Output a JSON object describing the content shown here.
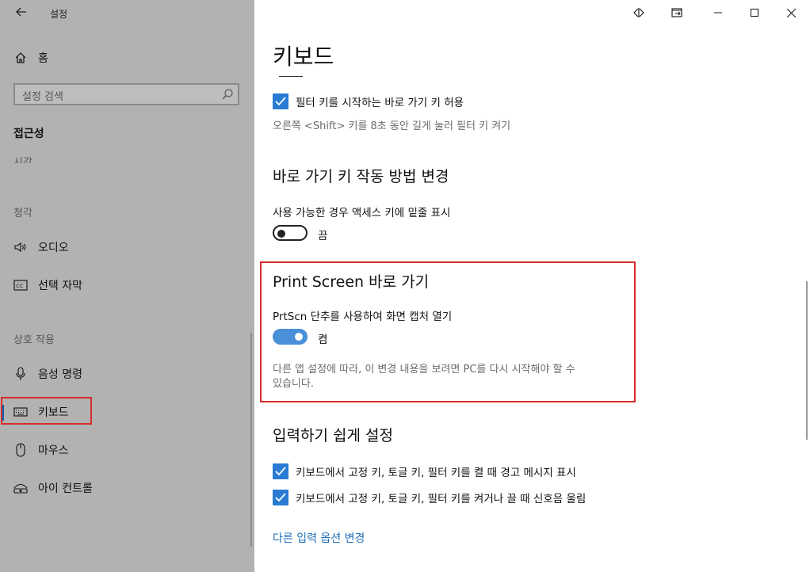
{
  "app": {
    "title": "설정"
  },
  "sidebar": {
    "home_label": "홈",
    "search_placeholder": "설정 검색",
    "section_title": "접근성",
    "group_vision": "시각",
    "group_hearing": "청각",
    "group_interaction": "상호 작용",
    "items": [
      {
        "label": "오디오",
        "icon": "speaker-icon"
      },
      {
        "label": "선택 자막",
        "icon": "closed-caption-icon"
      },
      {
        "label": "음성 명령",
        "icon": "microphone-icon"
      },
      {
        "label": "키보드",
        "icon": "keyboard-icon",
        "selected": true
      },
      {
        "label": "마우스",
        "icon": "mouse-icon"
      },
      {
        "label": "아이 컨트롤",
        "icon": "eye-icon"
      }
    ]
  },
  "main": {
    "page_title": "키보드",
    "filter_shortcut": {
      "label": "필터 키를 시작하는 바로 가기 키 허용",
      "checked": true,
      "help": "오른쪽 <Shift> 키를 8초 동안 길게 눌러 필터 키 켜기"
    },
    "shortcut_section": {
      "title": "바로 가기 키 작동 방법 변경",
      "setting_label": "사용 가능한 경우 액세스 키에 밑줄 표시",
      "toggle_state": "끔",
      "on": false
    },
    "print_screen": {
      "title": "Print Screen 바로 가기",
      "setting_label": "PrtScn 단추를 사용하여 화면 캡처 열기",
      "toggle_state": "켬",
      "on": true,
      "help_line1": "다른 앱 설정에 따라, 이 변경 내용을 보려면 PC를 다시 시작해야 할 수",
      "help_line2": "있습니다."
    },
    "typing": {
      "title": "입력하기 쉽게 설정",
      "check1": "키보드에서 고정 키, 토글 키, 필터 키를 켤 때 경고 메시지 표시",
      "check2": "키보드에서 고정 키, 토글 키, 필터 키를 켜거나 끌 때 신호음 울림"
    },
    "link": "다른 입력 옵션 변경"
  },
  "colors": {
    "accent": "#2a7bd3",
    "highlight": "#d92b2b",
    "sidebar_bg": "#b2b2b2",
    "link": "#1f6fb8"
  }
}
